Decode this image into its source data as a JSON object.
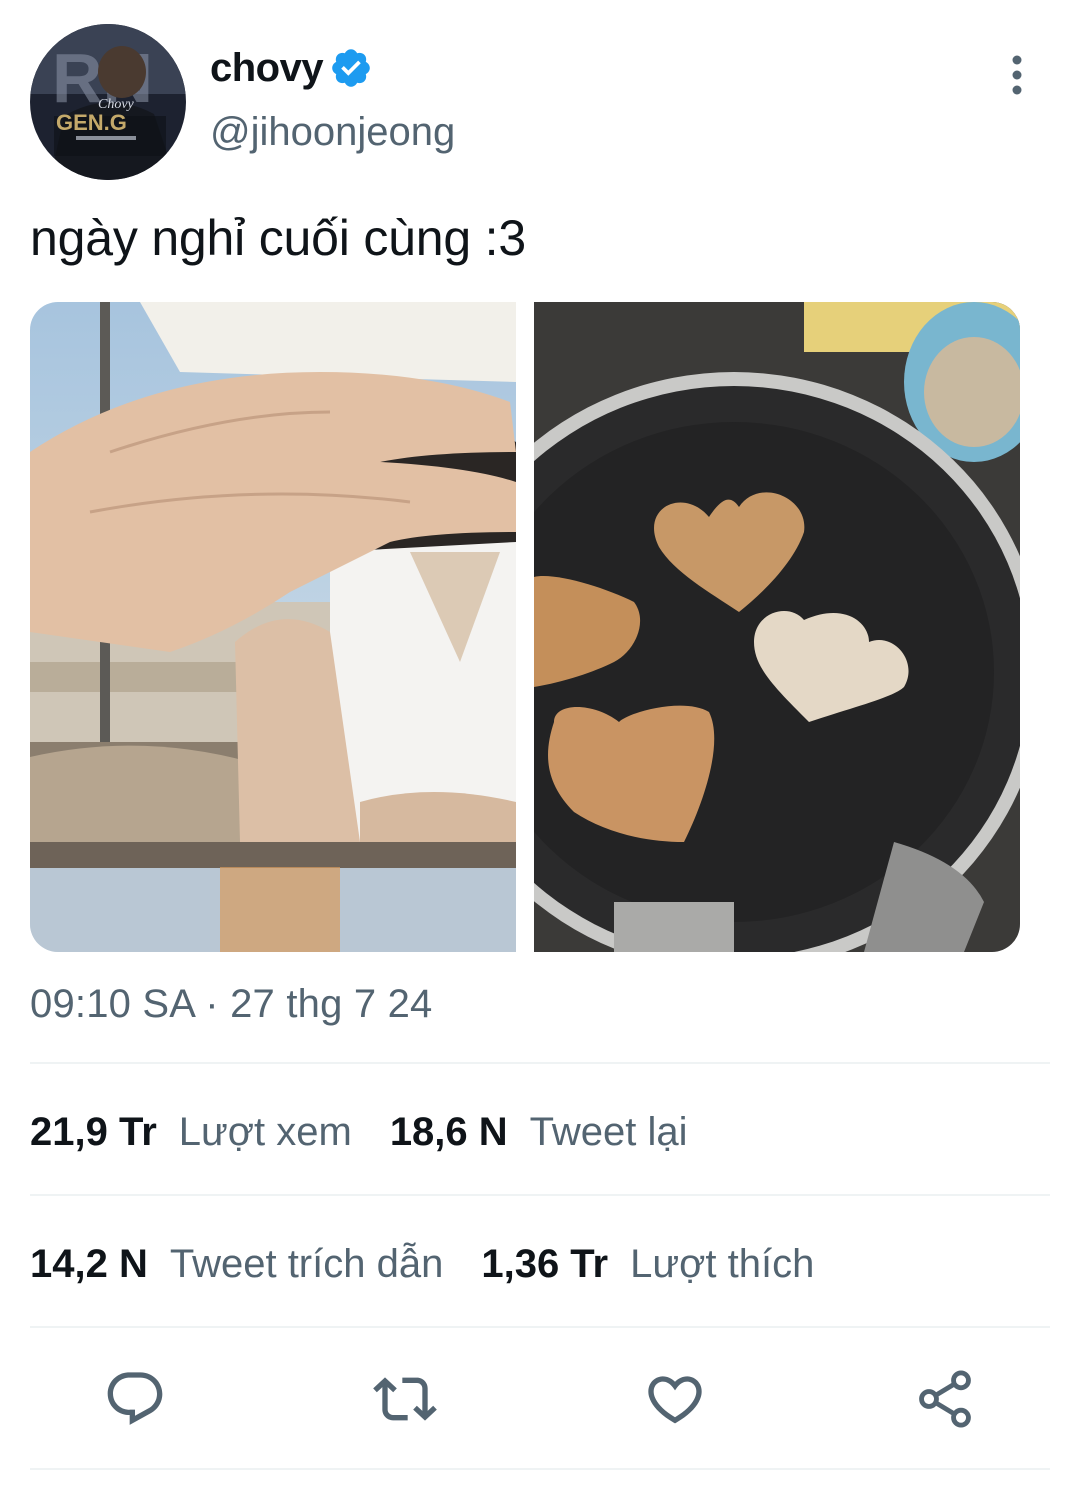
{
  "author": {
    "display_name": "chovy",
    "handle": "@jihoonjeong",
    "verified": true,
    "avatar_jersey_text": "GEN.G",
    "avatar_name_text": "Chovy"
  },
  "tweet": {
    "text": "ngày nghỉ cuối cùng :3",
    "timestamp": "09:10 SA · 27 thg 7 24"
  },
  "stats": {
    "views": {
      "value": "21,9 Tr",
      "label": "Lượt xem"
    },
    "retweets": {
      "value": "18,6 N",
      "label": "Tweet lại"
    },
    "quotes": {
      "value": "14,2 N",
      "label": "Tweet trích dẫn"
    },
    "likes": {
      "value": "1,36 Tr",
      "label": "Lượt thích"
    }
  },
  "icons": {
    "more": "more-vertical-icon",
    "verified": "verified-badge-icon",
    "reply": "reply-icon",
    "retweet": "retweet-icon",
    "like": "heart-icon",
    "share": "share-icon"
  },
  "colors": {
    "verified": "#1d9bf0",
    "secondary_text": "#536471",
    "action_icon": "#536471"
  }
}
